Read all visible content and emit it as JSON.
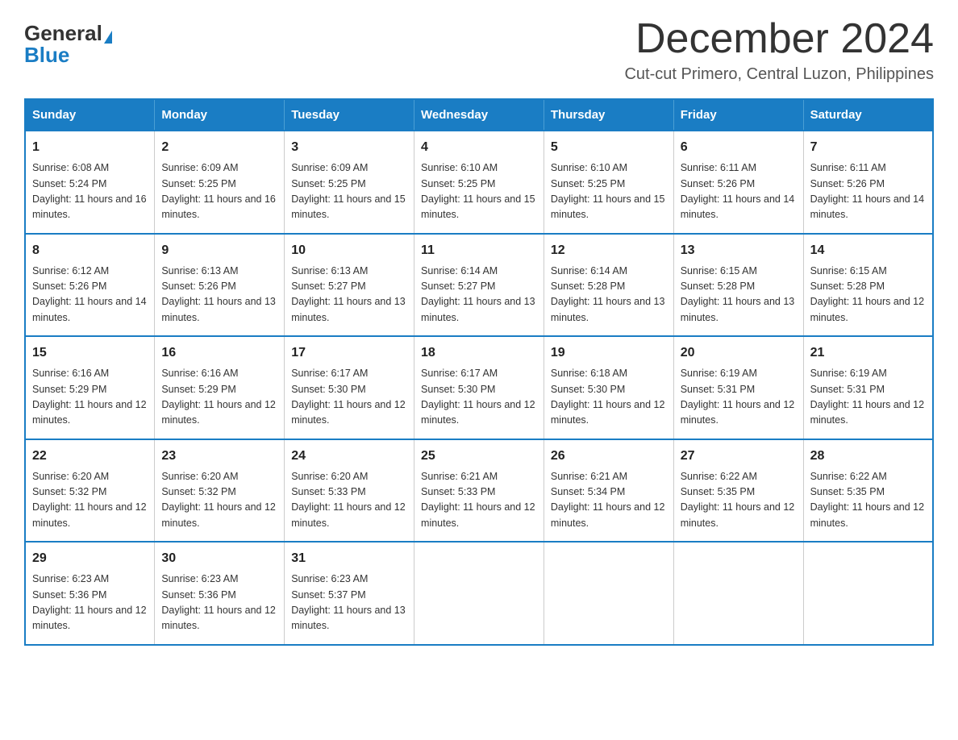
{
  "logo": {
    "general": "General",
    "blue": "Blue"
  },
  "header": {
    "month_year": "December 2024",
    "location": "Cut-cut Primero, Central Luzon, Philippines"
  },
  "weekdays": [
    "Sunday",
    "Monday",
    "Tuesday",
    "Wednesday",
    "Thursday",
    "Friday",
    "Saturday"
  ],
  "weeks": [
    [
      {
        "day": "1",
        "sunrise": "6:08 AM",
        "sunset": "5:24 PM",
        "daylight": "11 hours and 16 minutes."
      },
      {
        "day": "2",
        "sunrise": "6:09 AM",
        "sunset": "5:25 PM",
        "daylight": "11 hours and 16 minutes."
      },
      {
        "day": "3",
        "sunrise": "6:09 AM",
        "sunset": "5:25 PM",
        "daylight": "11 hours and 15 minutes."
      },
      {
        "day": "4",
        "sunrise": "6:10 AM",
        "sunset": "5:25 PM",
        "daylight": "11 hours and 15 minutes."
      },
      {
        "day": "5",
        "sunrise": "6:10 AM",
        "sunset": "5:25 PM",
        "daylight": "11 hours and 15 minutes."
      },
      {
        "day": "6",
        "sunrise": "6:11 AM",
        "sunset": "5:26 PM",
        "daylight": "11 hours and 14 minutes."
      },
      {
        "day": "7",
        "sunrise": "6:11 AM",
        "sunset": "5:26 PM",
        "daylight": "11 hours and 14 minutes."
      }
    ],
    [
      {
        "day": "8",
        "sunrise": "6:12 AM",
        "sunset": "5:26 PM",
        "daylight": "11 hours and 14 minutes."
      },
      {
        "day": "9",
        "sunrise": "6:13 AM",
        "sunset": "5:26 PM",
        "daylight": "11 hours and 13 minutes."
      },
      {
        "day": "10",
        "sunrise": "6:13 AM",
        "sunset": "5:27 PM",
        "daylight": "11 hours and 13 minutes."
      },
      {
        "day": "11",
        "sunrise": "6:14 AM",
        "sunset": "5:27 PM",
        "daylight": "11 hours and 13 minutes."
      },
      {
        "day": "12",
        "sunrise": "6:14 AM",
        "sunset": "5:28 PM",
        "daylight": "11 hours and 13 minutes."
      },
      {
        "day": "13",
        "sunrise": "6:15 AM",
        "sunset": "5:28 PM",
        "daylight": "11 hours and 13 minutes."
      },
      {
        "day": "14",
        "sunrise": "6:15 AM",
        "sunset": "5:28 PM",
        "daylight": "11 hours and 12 minutes."
      }
    ],
    [
      {
        "day": "15",
        "sunrise": "6:16 AM",
        "sunset": "5:29 PM",
        "daylight": "11 hours and 12 minutes."
      },
      {
        "day": "16",
        "sunrise": "6:16 AM",
        "sunset": "5:29 PM",
        "daylight": "11 hours and 12 minutes."
      },
      {
        "day": "17",
        "sunrise": "6:17 AM",
        "sunset": "5:30 PM",
        "daylight": "11 hours and 12 minutes."
      },
      {
        "day": "18",
        "sunrise": "6:17 AM",
        "sunset": "5:30 PM",
        "daylight": "11 hours and 12 minutes."
      },
      {
        "day": "19",
        "sunrise": "6:18 AM",
        "sunset": "5:30 PM",
        "daylight": "11 hours and 12 minutes."
      },
      {
        "day": "20",
        "sunrise": "6:19 AM",
        "sunset": "5:31 PM",
        "daylight": "11 hours and 12 minutes."
      },
      {
        "day": "21",
        "sunrise": "6:19 AM",
        "sunset": "5:31 PM",
        "daylight": "11 hours and 12 minutes."
      }
    ],
    [
      {
        "day": "22",
        "sunrise": "6:20 AM",
        "sunset": "5:32 PM",
        "daylight": "11 hours and 12 minutes."
      },
      {
        "day": "23",
        "sunrise": "6:20 AM",
        "sunset": "5:32 PM",
        "daylight": "11 hours and 12 minutes."
      },
      {
        "day": "24",
        "sunrise": "6:20 AM",
        "sunset": "5:33 PM",
        "daylight": "11 hours and 12 minutes."
      },
      {
        "day": "25",
        "sunrise": "6:21 AM",
        "sunset": "5:33 PM",
        "daylight": "11 hours and 12 minutes."
      },
      {
        "day": "26",
        "sunrise": "6:21 AM",
        "sunset": "5:34 PM",
        "daylight": "11 hours and 12 minutes."
      },
      {
        "day": "27",
        "sunrise": "6:22 AM",
        "sunset": "5:35 PM",
        "daylight": "11 hours and 12 minutes."
      },
      {
        "day": "28",
        "sunrise": "6:22 AM",
        "sunset": "5:35 PM",
        "daylight": "11 hours and 12 minutes."
      }
    ],
    [
      {
        "day": "29",
        "sunrise": "6:23 AM",
        "sunset": "5:36 PM",
        "daylight": "11 hours and 12 minutes."
      },
      {
        "day": "30",
        "sunrise": "6:23 AM",
        "sunset": "5:36 PM",
        "daylight": "11 hours and 12 minutes."
      },
      {
        "day": "31",
        "sunrise": "6:23 AM",
        "sunset": "5:37 PM",
        "daylight": "11 hours and 13 minutes."
      },
      {
        "day": "",
        "sunrise": "",
        "sunset": "",
        "daylight": ""
      },
      {
        "day": "",
        "sunrise": "",
        "sunset": "",
        "daylight": ""
      },
      {
        "day": "",
        "sunrise": "",
        "sunset": "",
        "daylight": ""
      },
      {
        "day": "",
        "sunrise": "",
        "sunset": "",
        "daylight": ""
      }
    ]
  ]
}
